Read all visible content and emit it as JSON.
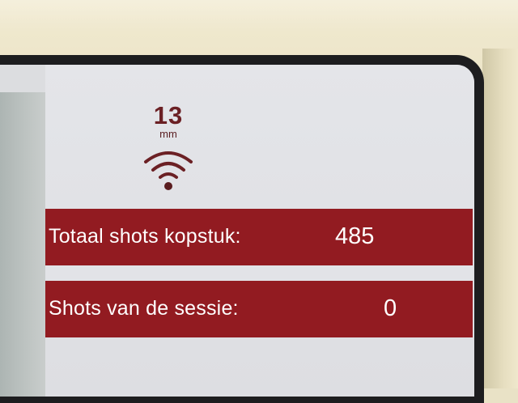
{
  "nozzle": {
    "size_value": "13",
    "size_unit": "mm",
    "connection_icon": "wifi-signal-icon"
  },
  "counters": {
    "total": {
      "label": "Totaal shots kopstuk:",
      "value": "485"
    },
    "session": {
      "label": "Shots van de sessie:",
      "value": "0"
    }
  },
  "colors": {
    "row_background": "#921b21",
    "accent_text": "#6b2024",
    "screen_background": "#e4e5e9"
  }
}
